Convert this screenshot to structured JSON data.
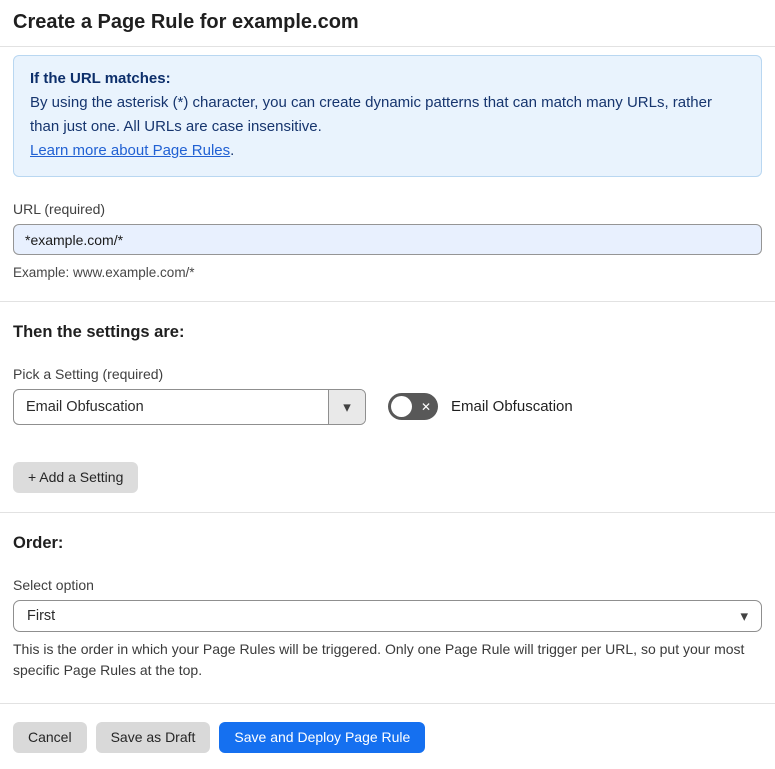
{
  "page": {
    "title": "Create a Page Rule for example.com"
  },
  "info_box": {
    "heading": "If the URL matches:",
    "body": "By using the asterisk (*) character, you can create dynamic patterns that can match many URLs, rather than just one. All URLs are case insensitive.",
    "link_label": "Learn more about Page Rules",
    "link_suffix": "."
  },
  "url_field": {
    "label": "URL (required)",
    "value": "*example.com/*",
    "helper": "Example: www.example.com/*"
  },
  "settings_section": {
    "heading": "Then the settings are:",
    "picker_label": "Pick a Setting (required)",
    "picker_value": "Email Obfuscation",
    "toggle_label": "Email Obfuscation",
    "toggle_state": "off",
    "add_setting_label": "+ Add a Setting"
  },
  "order_section": {
    "heading": "Order:",
    "select_label": "Select option",
    "select_value": "First",
    "helper": "This is the order in which your Page Rules will be triggered. Only one Page Rule will trigger per URL, so put your most specific Page Rules at the top."
  },
  "footer": {
    "cancel_label": "Cancel",
    "save_draft_label": "Save as Draft",
    "save_deploy_label": "Save and Deploy Page Rule"
  },
  "icons": {
    "dropdown_arrow": "▾",
    "toggle_cross": "✕"
  },
  "colors": {
    "accent_blue": "#1570f0",
    "info_background": "#e9f3fd",
    "info_border": "#b9d7f1",
    "info_text": "#16356e",
    "link_blue": "#2161d3",
    "input_background": "#e8f0fe",
    "toggle_off_background": "#585858",
    "button_gray": "#d9d9d9"
  }
}
